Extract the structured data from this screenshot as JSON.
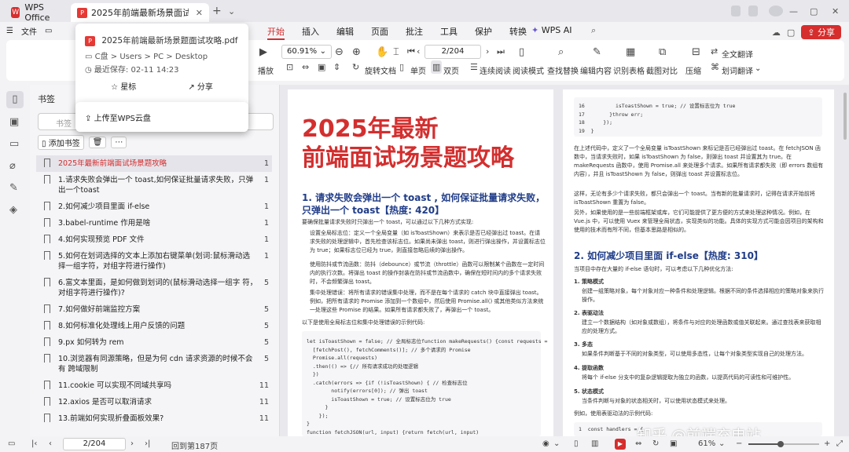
{
  "titlebar": {
    "home_tab": "WPS Office",
    "doc_tab": "2025年前端最新场景面试攻",
    "add_tab": "+"
  },
  "menubar": {
    "file": "文件",
    "tabs": [
      "开始",
      "插入",
      "编辑",
      "页面",
      "批注",
      "工具",
      "保护",
      "转换"
    ],
    "active_tab": "开始",
    "wps_ai": "WPS AI",
    "share": "分享"
  },
  "ribbon": {
    "zoom": "60.91%",
    "page": "2/204",
    "play": "播放",
    "rotate": "旋转文档",
    "single": "单页",
    "double": "双页",
    "continuous": "连续阅读",
    "read_mode": "阅读模式",
    "find_replace": "查找替换",
    "edit_content": "编辑内容",
    "ocr": "识别表格",
    "crop_compare": "截图对比",
    "compress": "压缩",
    "full_translate": "全文翻译",
    "word_translate": "划词翻译"
  },
  "popup": {
    "filename": "2025年前端最新场景题面试攻略.pdf",
    "path": "C盘 > Users > PC > Desktop",
    "last_saved": "最近保存: 02-11 14:23",
    "star": "星标",
    "share": "分享",
    "upload": "上传至WPS云盘"
  },
  "panel": {
    "title": "书签",
    "search_placeholder": "书签",
    "add_bookmark": "添加书签",
    "bookmarks": [
      {
        "text": "2025年最新前端面试场景题攻略",
        "page": "1"
      },
      {
        "text": "1.请求失败会弹出一个 toast,如何保证批量请求失败，只弹出一个toast",
        "page": "1"
      },
      {
        "text": "2.如何减少项目里面 if-else",
        "page": "1"
      },
      {
        "text": "3.babel-runtime 作用是啥",
        "page": "1"
      },
      {
        "text": "4.如何实现预览 PDF 文件",
        "page": "1"
      },
      {
        "text": "5.如何在划词选择的文本上添加右键菜单(划词:鼠标滑动选 择一组字符，对组字符进行操作)",
        "page": "1"
      },
      {
        "text": "6.富文本里面，是如何做到划词的(鼠标滑动选择一组字 符，对组字符进行操作)?",
        "page": "5"
      },
      {
        "text": "7.如何做好前端监控方案",
        "page": "5"
      },
      {
        "text": "8.如何标准化处理线上用户反馈的问题",
        "page": "5"
      },
      {
        "text": "9.px 如何转为 rem",
        "page": "5"
      },
      {
        "text": "10.浏览器有同源策略，但是为何 cdn 请求资源的时候不会有 跨域限制",
        "page": "5"
      },
      {
        "text": "11.cookie 可以实现不同域共享吗",
        "page": "11"
      },
      {
        "text": "12.axios 是否可以取消请求",
        "page": "11"
      },
      {
        "text": "13.前端如何实现折叠面板效果?",
        "page": "11"
      }
    ]
  },
  "page1": {
    "title_line1": "2025年最新",
    "title_line2": "前端面试场景题攻略",
    "h1": "1. 请求失败会弹出一个 toast , 如何保证批量请求失败， 只弹出一个 toast【热度: 420】",
    "intro": "要确保批量请求失败时只弹出一个 toast，可以通过以下几种方式实现:",
    "item1": "设置全局标志位：定义一个全局变量（如 isToastShown）来表示是否已经弹出过 toast。在请求失败的处理逻辑中，首先检查该标志位。如果尚未弹出 toast，则进行弹出操作，并设置标志位为 true；如果标志位已经为 true，则直接忽略后续的弹出操作。",
    "item2": "使用防抖或节流函数：防抖（debounce）或节流（throttle）函数可以限制某个函数在一定时间内的执行次数。将弹出 toast 的操作封装在防抖或节流函数中，确保在短时间内的多个请求失败时，不会频繁弹出 toast。",
    "item3": "集中处理错误：将所有请求的错误集中处理，而不是在每个请求的 catch 块中直接弹出 toast。例如，把所有请求的 Promise 添加到一个数组中，然后使用 Promise.all() 或其他类似方法来统一处理这些 Promise 的结果。如果所有请求都失败了，再弹出一个 toast。",
    "code_intro": "以下是使用全局标志位和集中处理错误的示例代码:",
    "code": [
      "let isToastShown = false; // 全局标志位function makeRequests() {const requests =",
      "  [fetchPost(), fetchComments()]; // 多个请求的 Promise",
      "  Promise.all(requests)",
      "  .then(() => {// 所有请求成功的处理逻辑",
      "  })",
      "  .catch(errors => {if (!isToastShown) { // 检查标志位",
      "        notify(errors[0]); // 弹出 toast",
      "        isToastShown = true; // 设置标志位为 true",
      "      }",
      "    });",
      "}",
      "",
      "function fetchJSON(url, input) {return fetch(url, input)",
      "  .then(res => {if (res.ok) {return res.json();"
    ]
  },
  "page2": {
    "code_top": [
      "16          isToastShown = true; // 设置标志位为 true",
      "17        }throw err;",
      "18      });",
      "19  }"
    ],
    "p1": "在上述代码中，定义了一个全局变量 isToastShown 来标记是否已经弹出过 toast。在 fetchJSON 函数中，当请求失败时，如果 isToastShown 为 false，则弹出 toast 并设置其为 true。在 makeRequests 函数中，使用 Promise.all 来处理多个请求。如果所有请求都失败（即 errors 数组有内容），并且 isToastShown 为 false，则弹出 toast 并设置标志位。",
    "p2": "这样，无论有多少个请求失败，都只会弹出一个 toast。当有新的批量请求时，记得在请求开始前将 isToastShown 重置为 false。",
    "p3": "另外，如果使用的是一些前端框架或库，它们可能提供了更方便的方式来处理这种情况。例如，在 Vue.js 中，可以使用 Vuex 来管理全局状态，实现类似的功能。具体的实现方式可能会因项目的架构和使用的技术而有所不同，但基本思路是相似的。",
    "h2": "2. 如何减少项目里面 if-else【热度: 310】",
    "intro2": "当项目中存在大量的 if-else 语句时，可以考虑以下几种优化方法:",
    "s1": "1. 策略模式",
    "s1d": "创建一组策略对象，每个对象对应一种条件和处理逻辑。根据不同的条件选择相应的策略对象来执行操作。",
    "s2": "2. 表驱动法",
    "s2d": "建立一个数据结构（如对象或数组），将条件与对应的处理函数或值关联起来。通过查找表来获取相应的处理方式。",
    "s3": "3. 多态",
    "s3d": "如果条件判断基于不同的对象类型，可以使用多态性，让每个对象类型实现自己的处理方法。",
    "s4": "4. 提取函数",
    "s4d": "将每个 if-else 分支中的复杂逻辑提取为独立的函数，以提高代码的可读性和可维护性。",
    "s5": "5. 状态模式",
    "s5d": "当条件判断与对象的状态相关时，可以使用状态模式来处理。",
    "example": "例如，使用表驱动法的示例代码:",
    "code_bottom": "1  const handlers = {"
  },
  "watermark": "知乎 @前端充电站",
  "statusbar": {
    "page": "2/204",
    "back": "回到第187页",
    "zoom": "61%"
  },
  "zoom_fraction": 0.45
}
